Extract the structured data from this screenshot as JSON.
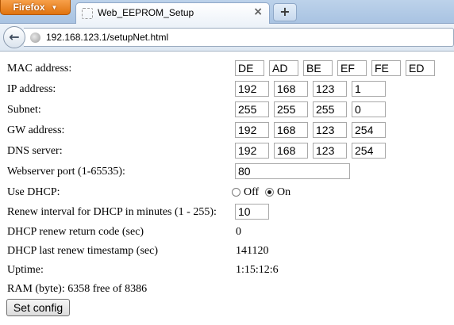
{
  "browser": {
    "app_button": "Firefox",
    "tab_title": "Web_EEPROM_Setup",
    "tab_close": "×",
    "new_tab": "+",
    "url": "192.168.123.1/setupNet.html",
    "back": "←"
  },
  "form": {
    "mac": {
      "label": "MAC address:",
      "octets": [
        "DE",
        "AD",
        "BE",
        "EF",
        "FE",
        "ED"
      ]
    },
    "ip": {
      "label": "IP address:",
      "octets": [
        "192",
        "168",
        "123",
        "1"
      ]
    },
    "subnet": {
      "label": "Subnet:",
      "octets": [
        "255",
        "255",
        "255",
        "0"
      ]
    },
    "gw": {
      "label": "GW address:",
      "octets": [
        "192",
        "168",
        "123",
        "254"
      ]
    },
    "dns": {
      "label": "DNS server:",
      "octets": [
        "192",
        "168",
        "123",
        "254"
      ]
    },
    "port": {
      "label": "Webserver port (1-65535):",
      "value": "80"
    },
    "dhcp": {
      "label": "Use DHCP:",
      "off_label": "Off",
      "on_label": "On",
      "selected": "On"
    },
    "renew": {
      "label": "Renew interval for DHCP in minutes (1 - 255):",
      "value": "10"
    },
    "return_code": {
      "label": "DHCP renew return code (sec)",
      "value": "0"
    },
    "last_renew": {
      "label": "DHCP last renew timestamp (sec)",
      "value": "141120"
    },
    "uptime": {
      "label": "Uptime:",
      "value": "1:15:12:6"
    },
    "ram": "RAM (byte): 6358 free of 8386",
    "submit_label": "Set config"
  }
}
